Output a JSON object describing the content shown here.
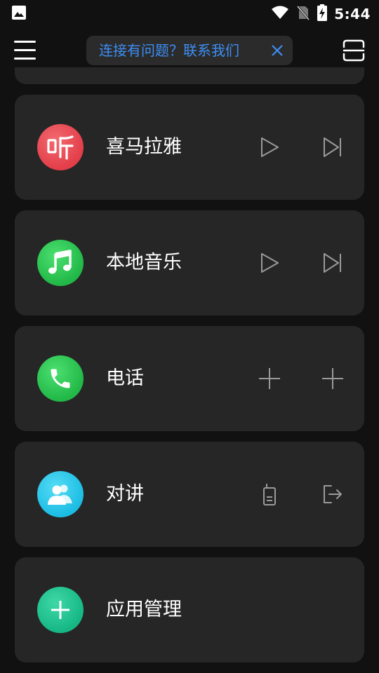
{
  "status_bar": {
    "time": "5:44"
  },
  "notice": {
    "text": "连接有问题？联系我们"
  },
  "apps": [
    {
      "name": "喜马拉雅",
      "icon": "ximalaya-ting-icon",
      "color": "#e8424d"
    },
    {
      "name": "本地音乐",
      "icon": "music-note-icon",
      "color": "#2ec954"
    },
    {
      "name": "电话",
      "icon": "phone-icon",
      "color": "#2ec954"
    },
    {
      "name": "对讲",
      "icon": "intercom-people-icon",
      "color": "#24c6e8"
    },
    {
      "name": "应用管理",
      "icon": "plus-icon",
      "color": "#19c08c"
    }
  ],
  "colors": {
    "background": "#111111",
    "card": "#262626",
    "accent_link": "#3d8ff5",
    "control_stroke": "#9a9a9a"
  }
}
